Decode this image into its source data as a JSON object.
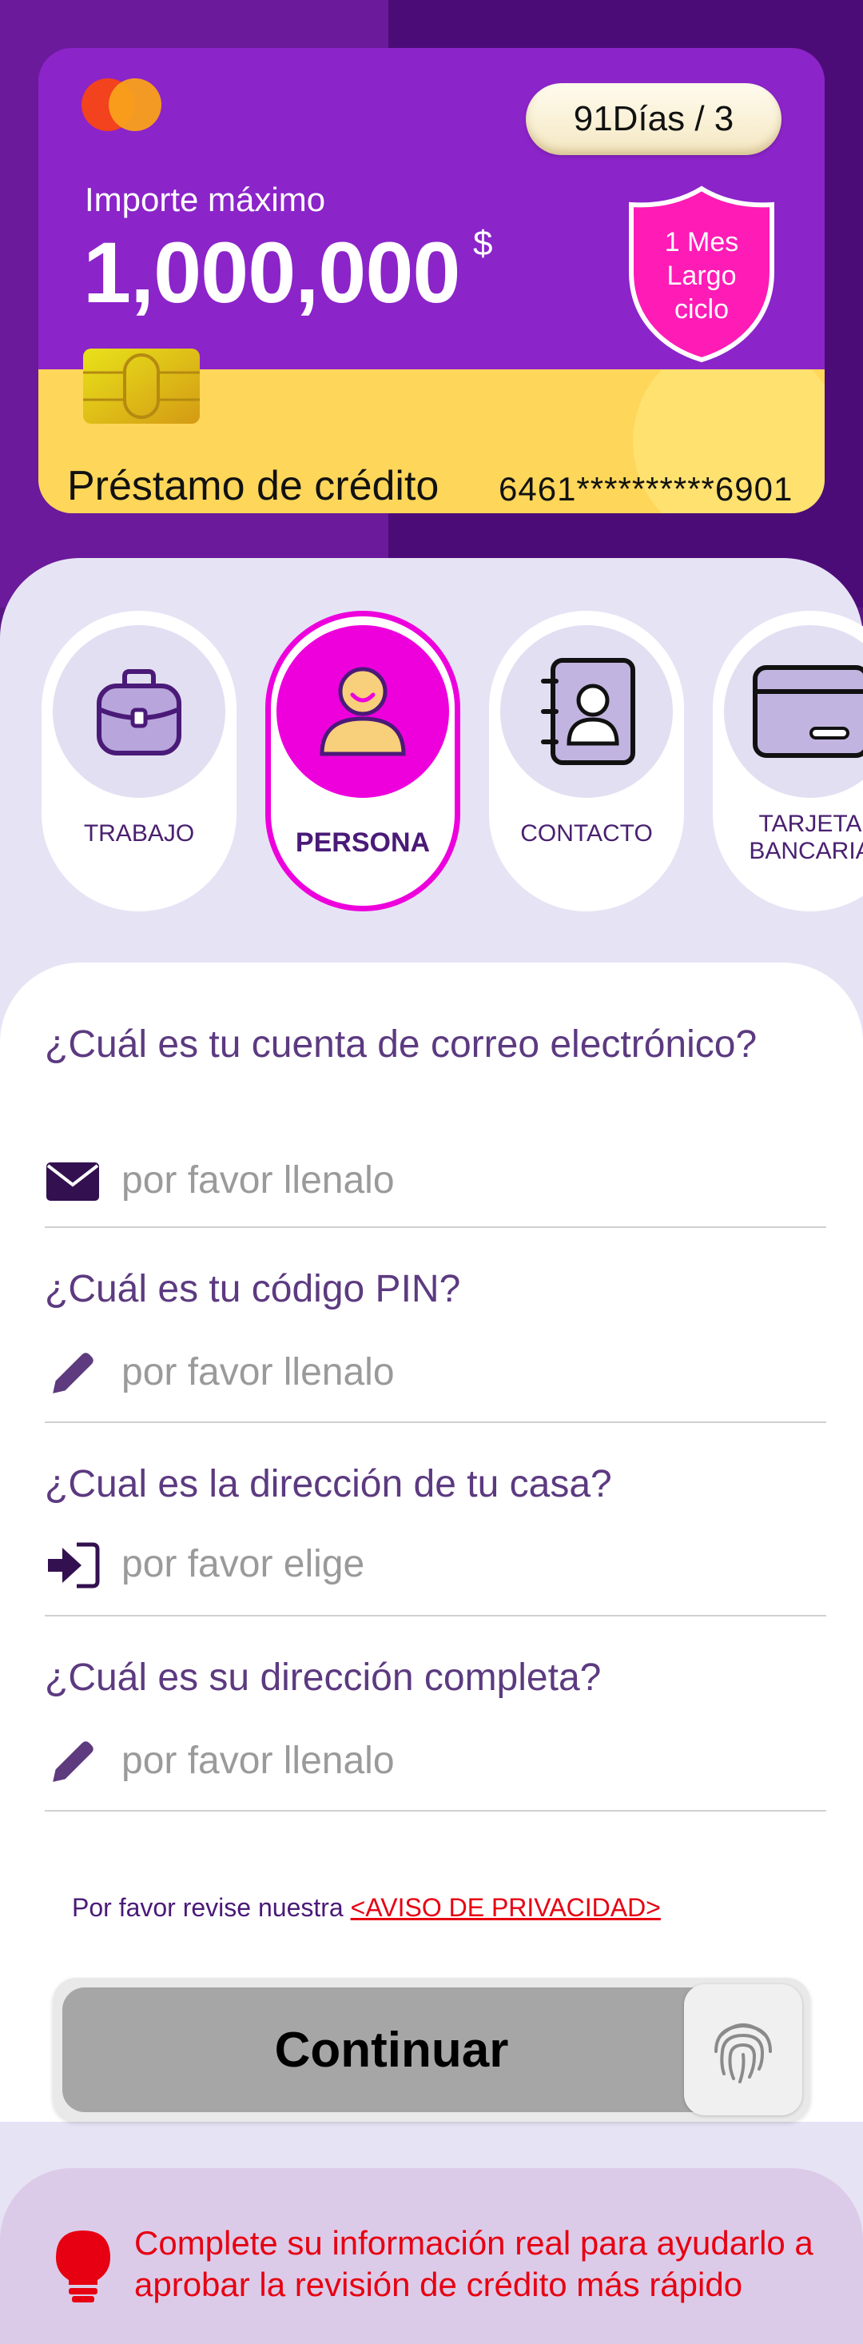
{
  "card": {
    "days_label": "91Días / 3",
    "amount_label": "Importe máximo",
    "amount": "1,000,000",
    "currency": "$",
    "shield_text": [
      "1 Mes",
      "Largo",
      "ciclo"
    ],
    "loan_title": "Préstamo de crédito",
    "card_number": "6461**********6901"
  },
  "steps": [
    {
      "label": "TRABAJO",
      "icon": "briefcase-icon",
      "active": false
    },
    {
      "label": "PERSONA",
      "icon": "person-icon",
      "active": true
    },
    {
      "label": "CONTACTO",
      "icon": "contact-book-icon",
      "active": false
    },
    {
      "label": "TARJETA BANCARIA",
      "icon": "bank-card-icon",
      "active": false
    }
  ],
  "form": {
    "fields": [
      {
        "question": "¿Cuál es tu cuenta de correo electrónico?",
        "placeholder": "por favor llenalo",
        "icon": "mail-icon"
      },
      {
        "question": "¿Cuál es tu código PIN?",
        "placeholder": "por favor llenalo",
        "icon": "pencil-icon"
      },
      {
        "question": "¿Cual es la dirección de tu casa?",
        "placeholder": "por favor elige",
        "icon": "sign-in-icon"
      },
      {
        "question": "¿Cuál es su dirección completa?",
        "placeholder": "por favor llenalo",
        "icon": "pencil-icon"
      }
    ]
  },
  "privacy": {
    "text": "Por favor revise nuestra ",
    "link": "<AVISO DE PRIVACIDAD>"
  },
  "continue_button": {
    "label": "Continuar",
    "icon": "fingerprint-icon"
  },
  "tip": {
    "icon": "lightbulb-icon",
    "text": "Complete su información real para ayudarlo a aprobar la revisión de crédito más rápido"
  },
  "colors": {
    "purple_dark": "#4c0c78",
    "card_purple": "#8b24c9",
    "card_yellow": "#fed659",
    "accent_magenta": "#ee00dd",
    "panel_lavender": "#e6e3f5",
    "tip_red": "#e60012"
  }
}
